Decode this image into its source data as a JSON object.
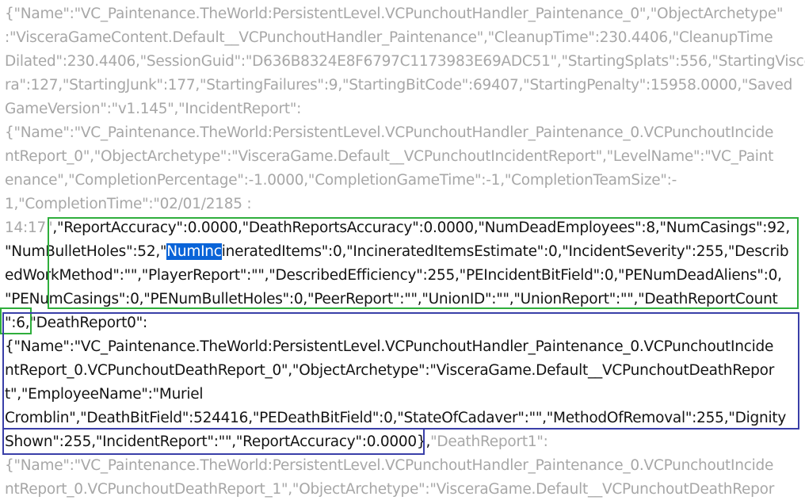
{
  "editor": {
    "lines": [
      [
        {
          "t": "{\"Name\":\"VC_Paintenance.TheWorld:PersistentLevel.VCPunchoutHandler_Paintenance_0\",\"ObjectArchetype\"",
          "c": "dim"
        }
      ],
      [
        {
          "t": ":\"VisceraGameContent.Default__VCPunchoutHandler_Paintenance\",\"CleanupTime\":230.4406,\"CleanupTime",
          "c": "dim"
        }
      ],
      [
        {
          "t": "Dilated\":230.4406,\"SessionGuid\":\"D636B8324E8F6797C1173983E69ADC51\",\"StartingSplats\":556,\"StartingVisce",
          "c": "dim"
        }
      ],
      [
        {
          "t": "ra\":127,\"StartingJunk\":177,\"StartingFailures\":9,\"StartingBitCode\":69407,\"StartingPenalty\":15958.0000,\"Saved",
          "c": "dim"
        }
      ],
      [
        {
          "t": "GameVersion\":\"v1.145\",\"IncidentReport\":",
          "c": "dim"
        }
      ],
      [
        {
          "t": "{\"Name\":\"VC_Paintenance.TheWorld:PersistentLevel.VCPunchoutHandler_Paintenance_0.VCPunchoutIncide",
          "c": "dim"
        }
      ],
      [
        {
          "t": "ntReport_0\",\"ObjectArchetype\":\"VisceraGame.Default__VCPunchoutIncidentReport\",\"LevelName\":\"VC_Paint",
          "c": "dim"
        }
      ],
      [
        {
          "t": "enance\",\"CompletionPercentage\":-1.0000,\"CompletionGameTime\":-1,\"CompletionTeamSize\":-",
          "c": "dim"
        }
      ],
      [
        {
          "t": "1,\"CompletionTime\":\"02/01/2185 :",
          "c": "dim"
        }
      ],
      [
        {
          "t": "14:17\"",
          "c": "dim"
        },
        {
          "t": ",\"ReportAccuracy\":0.0000,\"DeathReportsAccuracy\":0.0000,\"NumDeadEmployees\":8,\"NumCasings\":92,",
          "c": "dark"
        }
      ],
      [
        {
          "t": "\"NumBulletHoles\":52,\"",
          "c": "dark"
        },
        {
          "t": "NumInc",
          "c": "sel"
        },
        {
          "t": "ineratedItems\":0,\"IncineratedItemsEstimate\":0,\"IncidentSeverity\":255,\"Describ",
          "c": "dark"
        }
      ],
      [
        {
          "t": "edWorkMethod\":\"\",\"PlayerReport\":\"\",\"DescribedEfficiency\":255,\"PEIncidentBitField\":0,\"PENumDeadAliens\":0,",
          "c": "dark"
        }
      ],
      [
        {
          "t": "\"PENumCasings\":0,\"PENumBulletHoles\":0,\"PeerReport\":\"\",\"UnionID\":\"\",\"UnionReport\":\"\",\"DeathReportCount",
          "c": "dark"
        }
      ],
      [
        {
          "t": "\":6,\"DeathReport0\":",
          "c": "dark"
        }
      ],
      [
        {
          "t": "{\"Name\":\"VC_Paintenance.TheWorld:PersistentLevel.VCPunchoutHandler_Paintenance_0.VCPunchoutIncide",
          "c": "dark"
        }
      ],
      [
        {
          "t": "ntReport_0.VCPunchoutDeathReport_0\",\"ObjectArchetype\":\"VisceraGame.Default__VCPunchoutDeathRepor",
          "c": "dark"
        }
      ],
      [
        {
          "t": "t\",\"EmployeeName\":\"Muriel",
          "c": "dark"
        }
      ],
      [
        {
          "t": "Cromblin\",\"DeathBitField\":524416,\"PEDeathBitField\":0,\"StateOfCadaver\":\"\",\"MethodOfRemoval\":255,\"Dignity",
          "c": "dark"
        }
      ],
      [
        {
          "t": "Shown\":255,\"IncidentReport\":\"\",\"ReportAccuracy\":0.0000},",
          "c": "dark"
        },
        {
          "t": "\"DeathReport1\":",
          "c": "dim"
        }
      ],
      [
        {
          "t": "{\"Name\":\"VC_Paintenance.TheWorld:PersistentLevel.VCPunchoutHandler_Paintenance_0.VCPunchoutIncide",
          "c": "dim"
        }
      ],
      [
        {
          "t": "ntReport_0.VCPunchoutDeathReport_1\",\"ObjectArchetype\":\"VisceraGame.Default__VCPunchoutDeathRepor",
          "c": "dim"
        }
      ]
    ]
  },
  "colors": {
    "text_dim": "#a7a7a7",
    "text_dark": "#141414",
    "selection": "#0a64d8",
    "highlight_green": "#2fae3c",
    "highlight_blue": "#3a3fa8"
  }
}
